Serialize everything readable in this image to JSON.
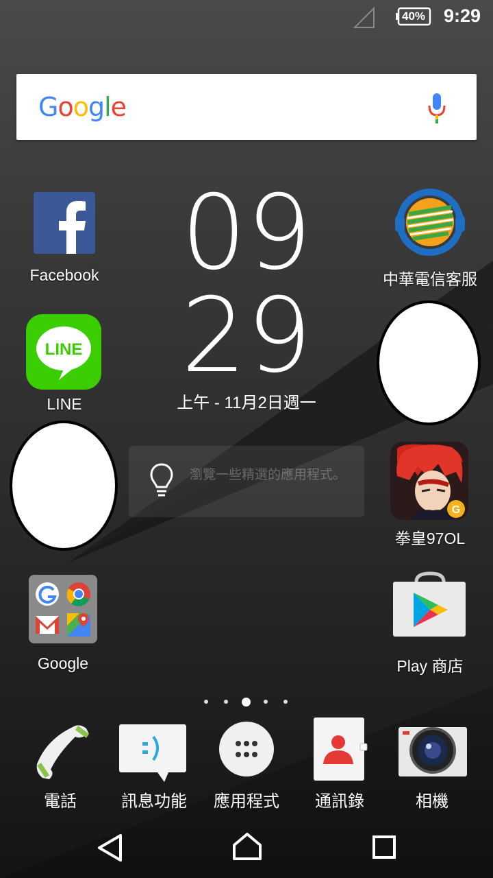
{
  "status": {
    "battery": "40%",
    "time": "9:29"
  },
  "search": {
    "logo_letters": [
      "G",
      "o",
      "o",
      "g",
      "l",
      "e"
    ]
  },
  "apps": {
    "facebook": "Facebook",
    "cht": "中華電信客服",
    "line": "LINE",
    "kof": "拳皇97OL",
    "google_folder": "Google",
    "play": "Play 商店"
  },
  "clock": {
    "hour": "09",
    "minute": "29",
    "date": "上午 - 11月2日週一"
  },
  "tip": {
    "text": "瀏覽一些精選的應用程式。"
  },
  "dock": {
    "phone": "電話",
    "messaging": "訊息功能",
    "apps": "應用程式",
    "contacts": "通訊錄",
    "camera": "相機"
  },
  "pager": {
    "pages": 5,
    "current": 3
  },
  "colors": {
    "google_blue": "#4285F4",
    "google_red": "#EA4335",
    "google_yellow": "#FBBC05",
    "google_green": "#34A853",
    "facebook": "#3b5998",
    "line": "#3ACD01"
  }
}
